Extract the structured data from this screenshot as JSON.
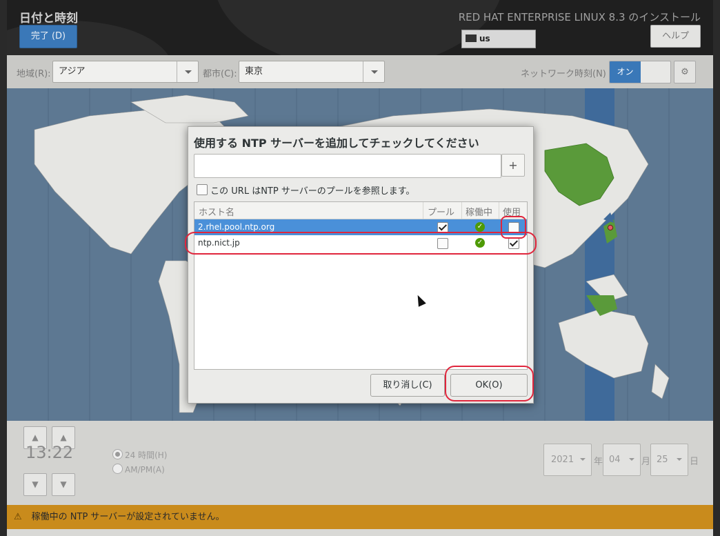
{
  "header": {
    "title": "日付と時刻",
    "done_label": "完了 (D)",
    "product": "RED HAT ENTERPRISE LINUX 8.3 のインストール",
    "keyboard_layout": "us",
    "help_label": "ヘルプ"
  },
  "location_bar": {
    "region_label": "地域(R):",
    "region_value": "アジア",
    "city_label": "都市(C):",
    "city_value": "東京",
    "network_time_label": "ネットワーク時刻(N)",
    "network_time_state": "オン",
    "settings_icon": "gear-icon"
  },
  "time": {
    "value": "13:22",
    "format_24h": "24 時間(H)",
    "format_ampm": "AM/PM(A)",
    "selected_format": "24h"
  },
  "date": {
    "year": "2021",
    "year_unit": "年",
    "month": "04",
    "month_unit": "月",
    "day": "25",
    "day_unit": "日"
  },
  "warning": {
    "icon": "warning-icon",
    "text": "稼働中の NTP サーバーが設定されていません。"
  },
  "dialog": {
    "title": "使用する NTP サーバーを追加してチェックしてください",
    "url_input_value": "",
    "add_button": "+",
    "pool_checkbox_label": "この URL はNTP サーバーのプールを参照します。",
    "pool_checkbox_checked": false,
    "columns": {
      "host": "ホスト名",
      "pool": "プール",
      "working": "稼働中",
      "use": "使用"
    },
    "servers": [
      {
        "host": "2.rhel.pool.ntp.org",
        "pool": true,
        "working": true,
        "use": false,
        "selected": true
      },
      {
        "host": "ntp.nict.jp",
        "pool": false,
        "working": true,
        "use": true,
        "selected": false
      }
    ],
    "cancel_label": "取り消し(C)",
    "ok_label": "OK(O)"
  },
  "colors": {
    "accent": "#3a78b8",
    "selection": "#4a90d9",
    "warning_bar": "#c98b1c",
    "annotation": "#e0253c",
    "map_ocean": "#5d7892",
    "map_land": "#e6e6e3",
    "map_highlight": "#5a9a3a"
  }
}
